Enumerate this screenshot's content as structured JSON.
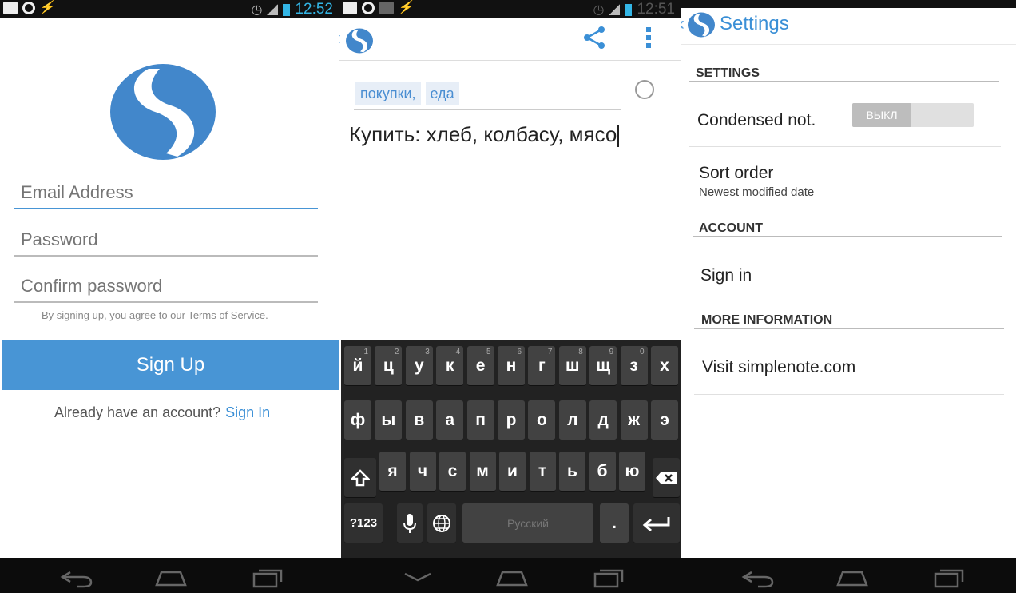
{
  "status_bars": [
    {
      "time": "12:52"
    },
    {
      "time": "12:51"
    },
    {
      "time": ""
    }
  ],
  "signup": {
    "email_placeholder": "Email Address",
    "password_placeholder": "Password",
    "confirm_placeholder": "Confirm password",
    "terms_prefix": "By signing up, you agree to our ",
    "terms_link": "Terms of Service.",
    "signup_button": "Sign Up",
    "already_text": "Already have an account?",
    "signin_link": "Sign In"
  },
  "editor": {
    "tags": [
      "покупки,",
      "еда"
    ],
    "note_text": "Купить: хлеб, колбасу, мясо"
  },
  "keyboard": {
    "row1": [
      {
        "k": "й",
        "h": "1"
      },
      {
        "k": "ц",
        "h": "2"
      },
      {
        "k": "у",
        "h": "3"
      },
      {
        "k": "к",
        "h": "4"
      },
      {
        "k": "е",
        "h": "5"
      },
      {
        "k": "н",
        "h": "6"
      },
      {
        "k": "г",
        "h": "7"
      },
      {
        "k": "ш",
        "h": "8"
      },
      {
        "k": "щ",
        "h": "9"
      },
      {
        "k": "з",
        "h": "0"
      },
      {
        "k": "х",
        "h": ""
      }
    ],
    "row2": [
      "ф",
      "ы",
      "в",
      "а",
      "п",
      "р",
      "о",
      "л",
      "д",
      "ж",
      "э"
    ],
    "row3": [
      "я",
      "ч",
      "с",
      "м",
      "и",
      "т",
      "ь",
      "б",
      "ю"
    ],
    "symbols_key": "?123",
    "space_label": "Русский",
    "period_key": "."
  },
  "settings": {
    "title": "Settings",
    "section_settings": "SETTINGS",
    "condensed_label": "Condensed not.",
    "condensed_toggle": "ВЫКЛ",
    "sort_order_label": "Sort order",
    "sort_order_value": "Newest modified date",
    "section_account": "ACCOUNT",
    "sign_in": "Sign in",
    "section_more": "MORE INFORMATION",
    "visit": "Visit simplenote.com"
  },
  "colors": {
    "accent": "#4895d5",
    "link": "#3a8fd6",
    "keyboard_bg": "#222222",
    "key_bg": "#424242"
  },
  "icons": [
    "back-nav-icon",
    "home-nav-icon",
    "recents-nav-icon",
    "share-icon",
    "overflow-menu-icon",
    "simplenote-logo",
    "shift-icon",
    "mic-icon",
    "globe-icon",
    "backspace-icon",
    "enter-icon"
  ]
}
